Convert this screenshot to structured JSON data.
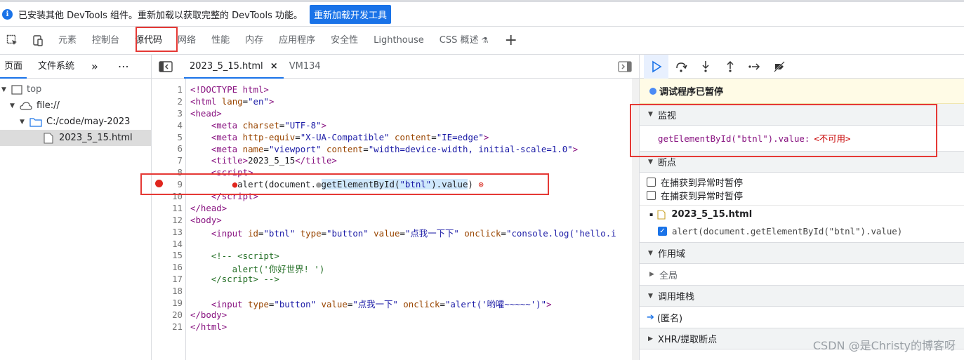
{
  "infobar": {
    "message": "已安装其他 DevTools 组件。重新加载以获取完整的 DevTools 功能。",
    "reload_button": "重新加载开发工具"
  },
  "main_tabs": [
    "元素",
    "控制台",
    "源代码",
    "网络",
    "性能",
    "内存",
    "应用程序",
    "安全性",
    "Lighthouse",
    "CSS 概述"
  ],
  "active_main_tab": "源代码",
  "navigator": {
    "tabs": [
      "页面",
      "文件系统"
    ],
    "tree": {
      "top": "top",
      "origin": "file://",
      "folder": "C:/code/may-2023",
      "file": "2023_5_15.html"
    }
  },
  "editor": {
    "tabs": [
      {
        "label": "2023_5_15.html",
        "close": "×"
      },
      {
        "label": "VM134"
      }
    ],
    "line_numbers": [
      "1",
      "2",
      "3",
      "4",
      "5",
      "6",
      "7",
      "8",
      "9",
      "10",
      "11",
      "12",
      "13",
      "14",
      "15",
      "16",
      "17",
      "18",
      "19",
      "20",
      "21"
    ],
    "breakpoint_line": "9"
  },
  "debugger": {
    "paused_label": "调试程序已暂停",
    "watch": {
      "title": "监视",
      "expression": "getElementById(\"btnl\").value:",
      "result": "<不可用>"
    },
    "breakpoints": {
      "title": "断点",
      "options": [
        "在捕获到异常时暂停",
        "在捕获到异常时暂停"
      ],
      "file": "2023_5_15.html",
      "entry": "alert(document.getElementById(\"btnl\").value)"
    },
    "scope": {
      "title": "作用域",
      "global": "全局"
    },
    "callstack": {
      "title": "调用堆栈",
      "frame": "(匿名)"
    },
    "xhr": {
      "title": "XHR/提取断点"
    }
  },
  "watermark": "CSDN @是Christy的博客呀",
  "colors": {
    "accent": "#1a73e8",
    "highlight_box": "#e53935",
    "breakpoint": "#e0261e"
  }
}
